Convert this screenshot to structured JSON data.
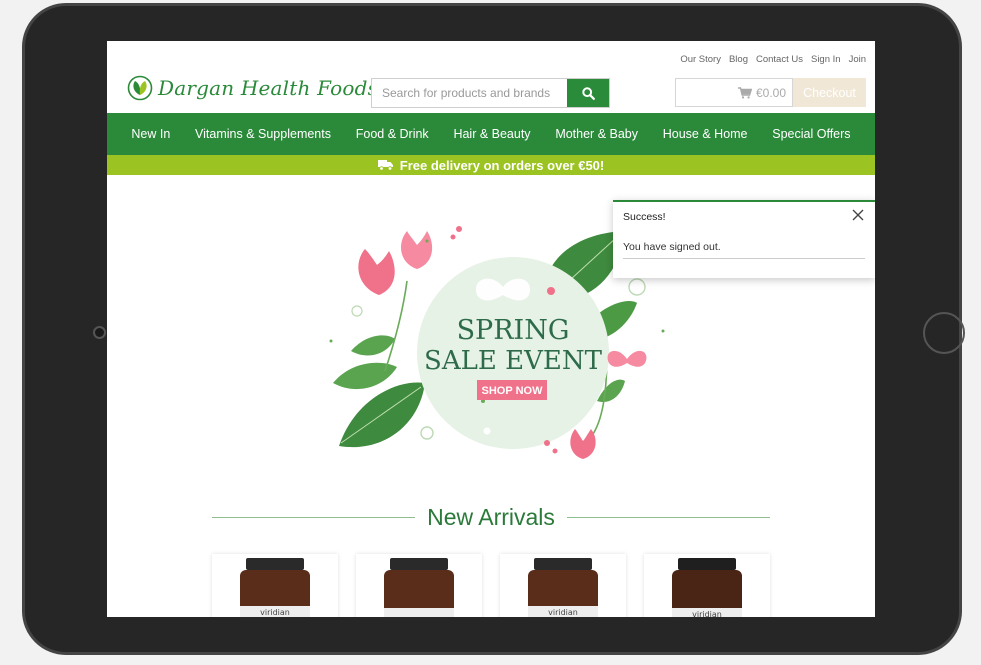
{
  "header": {
    "top_links": [
      "Our Story",
      "Blog",
      "Contact Us",
      "Sign In",
      "Join"
    ],
    "logo_text": "Dargan Health Foods",
    "search_placeholder": "Search for products and brands",
    "cart_total": "€0.00",
    "checkout_label": "Checkout"
  },
  "nav": {
    "items": [
      "New In",
      "Vitamins & Supplements",
      "Food & Drink",
      "Hair & Beauty",
      "Mother & Baby",
      "House & Home",
      "Special Offers"
    ]
  },
  "promo": {
    "text": "Free delivery on orders over €50!"
  },
  "banner": {
    "line1": "SPRING",
    "line2": "SALE EVENT",
    "cta": "SHOP NOW"
  },
  "toast": {
    "title": "Success!",
    "message": "You have signed out."
  },
  "arrivals": {
    "heading": "New Arrivals",
    "products": [
      {
        "brand": "viridian"
      },
      {
        "brand": ""
      },
      {
        "brand": "viridian"
      },
      {
        "brand": "viridian"
      }
    ]
  },
  "colors": {
    "brand_green": "#2b8a3a",
    "promo_green": "#9bc322",
    "checkout_bg": "#f0e7d6"
  }
}
